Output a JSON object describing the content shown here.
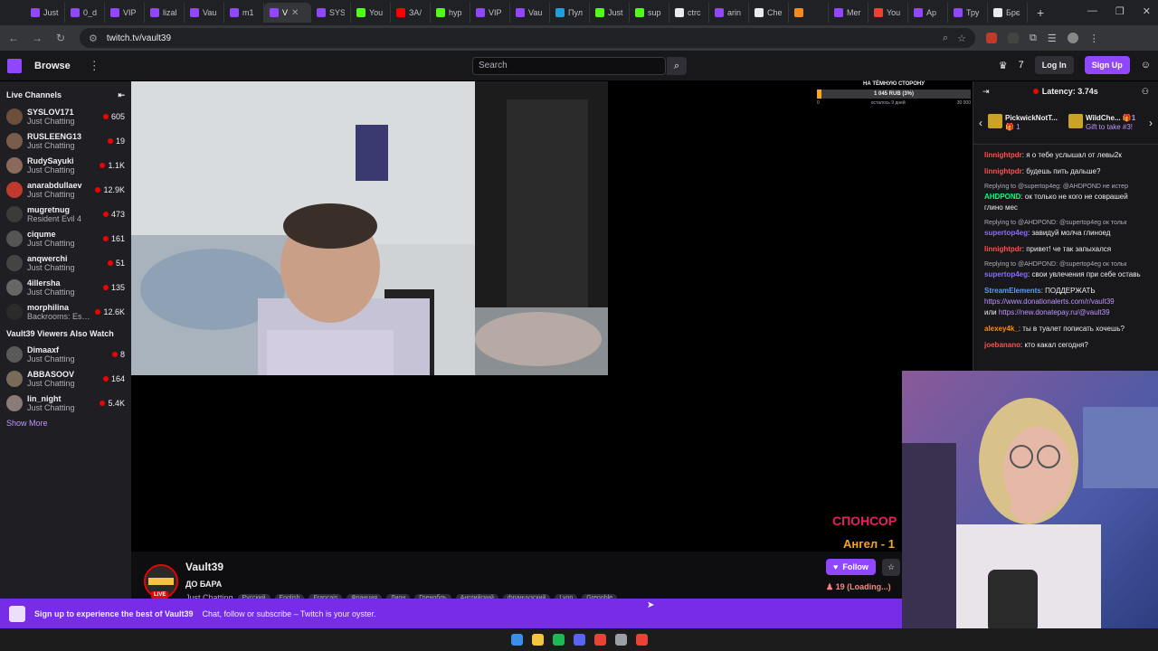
{
  "browser": {
    "tabs": [
      {
        "label": "Just",
        "color": "#9146ff"
      },
      {
        "label": "0_d",
        "color": "#9146ff"
      },
      {
        "label": "VIP",
        "color": "#9146ff"
      },
      {
        "label": "lizal",
        "color": "#9146ff"
      },
      {
        "label": "Vau",
        "color": "#9146ff"
      },
      {
        "label": "m1",
        "color": "#9146ff"
      },
      {
        "label": "V",
        "color": "#9146ff",
        "active": true
      },
      {
        "label": "SYS",
        "color": "#9146ff"
      },
      {
        "label": "You",
        "color": "#53fc18"
      },
      {
        "label": "ЗА/",
        "color": "#ff0000"
      },
      {
        "label": "hyp",
        "color": "#53fc18"
      },
      {
        "label": "VIP",
        "color": "#9146ff"
      },
      {
        "label": "Vau",
        "color": "#9146ff"
      },
      {
        "label": "Пул",
        "color": "#229ed9"
      },
      {
        "label": "Just",
        "color": "#53fc18"
      },
      {
        "label": "sup",
        "color": "#53fc18"
      },
      {
        "label": "ctrc",
        "color": "#e8eaed"
      },
      {
        "label": "arin",
        "color": "#9146ff"
      },
      {
        "label": "Che",
        "color": "#e8eaed"
      },
      {
        "label": "",
        "color": "#f28b20"
      },
      {
        "label": "Mer",
        "color": "#9146ff"
      },
      {
        "label": "You",
        "color": "#ea4335"
      },
      {
        "label": "Ap",
        "color": "#9146ff"
      },
      {
        "label": "Тру",
        "color": "#9146ff"
      },
      {
        "label": "Брє",
        "color": "#e8eaed"
      }
    ],
    "new_tab": "+",
    "url": "twitch.tv/vault39"
  },
  "topnav": {
    "browse": "Browse",
    "search_placeholder": "Search",
    "login": "Log In",
    "signup": "Sign Up"
  },
  "sidebar": {
    "live_header": "Live Channels",
    "channels": [
      {
        "name": "SYSLOV171",
        "category": "Just Chatting",
        "viewers": "605",
        "color": "#6b4f3a"
      },
      {
        "name": "RUSLEENG13",
        "category": "Just Chatting",
        "viewers": "19",
        "color": "#7a5c4a"
      },
      {
        "name": "RudySayuki",
        "category": "Just Chatting",
        "viewers": "1.1K",
        "color": "#8a6a5a"
      },
      {
        "name": "anarabdullaev",
        "category": "Just Chatting",
        "viewers": "12.9K",
        "color": "#c0392b"
      },
      {
        "name": "mugretnug",
        "category": "Resident Evil 4",
        "viewers": "473",
        "color": "#3b3b3b"
      },
      {
        "name": "ciqume",
        "category": "Just Chatting",
        "viewers": "161",
        "color": "#555555"
      },
      {
        "name": "anqwerchi",
        "category": "Just Chatting",
        "viewers": "51",
        "color": "#444444"
      },
      {
        "name": "4illersha",
        "category": "Just Chatting",
        "viewers": "135",
        "color": "#666666"
      },
      {
        "name": "morphilina",
        "category": "Backrooms: Esc...",
        "viewers": "12.6K",
        "color": "#2b2b2b"
      }
    ],
    "also_watch_header": "Vault39 Viewers Also Watch",
    "also_watch": [
      {
        "name": "Dimaaxf",
        "category": "Just Chatting",
        "viewers": "8",
        "color": "#5a5a5a"
      },
      {
        "name": "ABBASOOV",
        "category": "Just Chatting",
        "viewers": "164",
        "color": "#7a6a5a"
      },
      {
        "name": "lin_night",
        "category": "Just Chatting",
        "viewers": "5.4K",
        "color": "#8a7a7a"
      }
    ],
    "show_more": "Show More"
  },
  "player": {
    "goal_title": "НА ТЁМНУЮ СТОРОНУ",
    "goal_amount": "1 045 RUB (3%)",
    "goal_progress": 0.03,
    "goal_start": "0",
    "goal_remaining": "осталось 9 дней",
    "goal_target": "30 000",
    "sponsors": "СПОНСОР",
    "angel": "Ангел - 1"
  },
  "channel": {
    "name": "Vault39",
    "title": "ДО БАРА",
    "category": "Just Chatting",
    "tags": [
      "Русский",
      "English",
      "Français",
      "Франция",
      "Лион",
      "Гренобль",
      "Английский",
      "французский",
      "Lyon",
      "Grenoble"
    ],
    "follow": "Follow",
    "viewers": "19 (Loading...)",
    "live": "LIVE"
  },
  "chat": {
    "latency": "Latency: 3.74s",
    "pinned": [
      {
        "name": "PickwickNotT...",
        "count": "1"
      },
      {
        "name": "WildChe...",
        "count": "1",
        "sub": "Gift to take #3!"
      }
    ],
    "messages": [
      {
        "user": "linnightpdr",
        "color": "#ff4f4f",
        "text": "я о тебе услышал от левы2к"
      },
      {
        "user": "linnightpdr",
        "color": "#ff4f4f",
        "text": "будешь пить дальше?"
      },
      {
        "reply": "Replying to @supertop4eg: @AHDPOND не истер",
        "user": "AHDPOND",
        "color": "#00ff7f",
        "text": "ок только не кого не соврашей глино мес"
      },
      {
        "reply": "Replying to @AHDPOND: @supertop4eg ок тольк",
        "user": "supertop4eg",
        "color": "#8a6bff",
        "text": "завидуй молча глиноед"
      },
      {
        "user": "linnightpdr",
        "color": "#ff4f4f",
        "text": "привет! че так запыхался"
      },
      {
        "reply": "Replying to @AHDPOND: @supertop4eg ок тольк",
        "user": "supertop4eg",
        "color": "#8a6bff",
        "text": "свои увлечения при себе оставь"
      },
      {
        "user": "StreamElements",
        "color": "#5b9bff",
        "text": "ПОДДЕРЖАТЬ",
        "link1": "https://www.donationalerts.com/r/vault39",
        "or": "или",
        "link2": "https://new.donatepay.ru/@vault39"
      },
      {
        "user": "alexey4k_",
        "color": "#ff8c00",
        "text": "ты в туалет пописать хочешь?"
      },
      {
        "user": "joebanano",
        "color": "#ff4f4f",
        "text": "кто какал сегодня?"
      }
    ]
  },
  "signup_banner": {
    "main": "Sign up to experience the best of Vault39",
    "sub": "Chat, follow or subscribe – Twitch is your oyster."
  },
  "taskbar": {
    "apps": [
      {
        "name": "windows",
        "color": "#3b8eea"
      },
      {
        "name": "explorer",
        "color": "#f5c542"
      },
      {
        "name": "spotify",
        "color": "#1db954"
      },
      {
        "name": "discord",
        "color": "#5865f2"
      },
      {
        "name": "chrome",
        "color": "#ea4335"
      },
      {
        "name": "files",
        "color": "#9aa0a6"
      },
      {
        "name": "chrome-alt",
        "color": "#ea4335"
      }
    ]
  }
}
